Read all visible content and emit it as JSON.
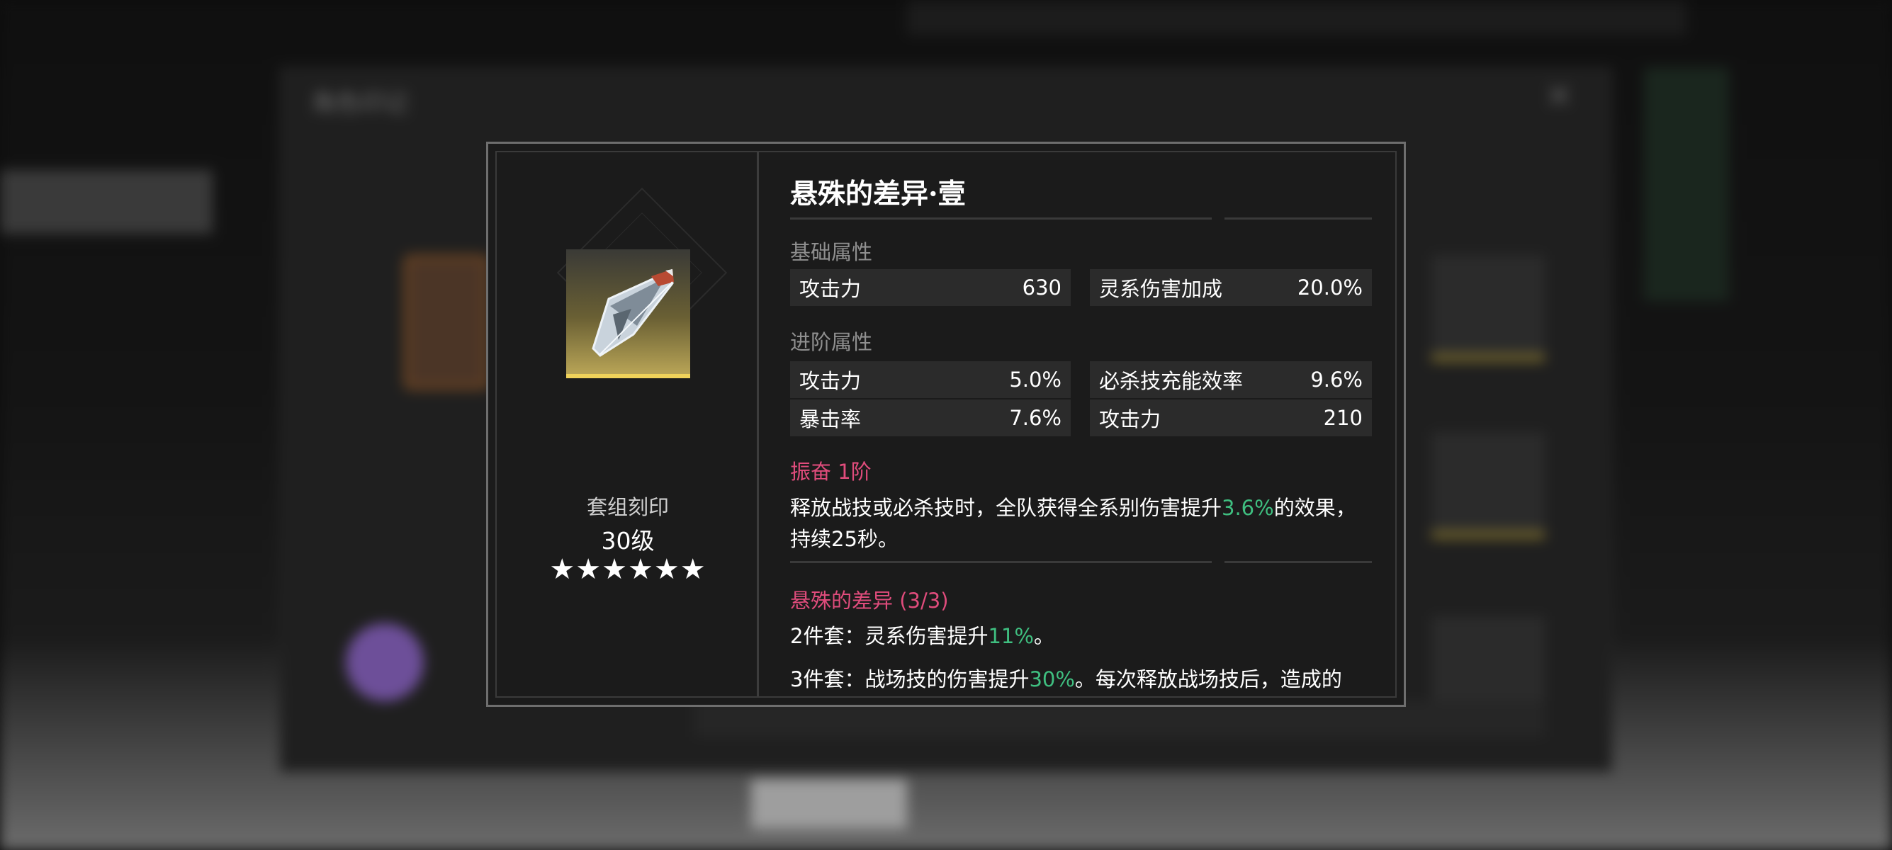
{
  "background": {
    "panel_title": "角色印记",
    "close_glyph": "✕"
  },
  "item": {
    "name": "悬殊的差异·壹",
    "icon": "blade-fragment-icon",
    "set_label": "套组刻印",
    "level": "30级",
    "stars": "★★★★★★",
    "star_count": 6
  },
  "base_stats": {
    "heading": "基础属性",
    "rows": [
      {
        "label": "攻击力",
        "value": "630"
      },
      {
        "label": "灵系伤害加成",
        "value": "20.0%"
      }
    ]
  },
  "advanced_stats": {
    "heading": "进阶属性",
    "rows": [
      {
        "label": "攻击力",
        "value": "5.0%"
      },
      {
        "label": "必杀技充能效率",
        "value": "9.6%"
      },
      {
        "label": "暴击率",
        "value": "7.6%"
      },
      {
        "label": "攻击力",
        "value": "210"
      }
    ]
  },
  "excite": {
    "heading": "振奋 1阶",
    "desc_before": "释放战技或必杀技时，全队获得全系别伤害提升",
    "desc_highlight": "3.6%",
    "desc_after": "的效果，持续25秒。"
  },
  "set_bonus": {
    "heading": "悬殊的差异 (3/3)",
    "two_piece_before": "2件套：灵系伤害提升",
    "two_piece_highlight": "11%",
    "two_piece_after": "。",
    "three_piece_before": "3件套：战场技的伤害提升",
    "three_piece_highlight": "30%",
    "three_piece_after": "。每次释放战场技后，造成的"
  },
  "colors": {
    "accent_pink": "#e04c7c",
    "highlight_green": "#3fbf80",
    "icon_gold": "#f0d25a"
  }
}
